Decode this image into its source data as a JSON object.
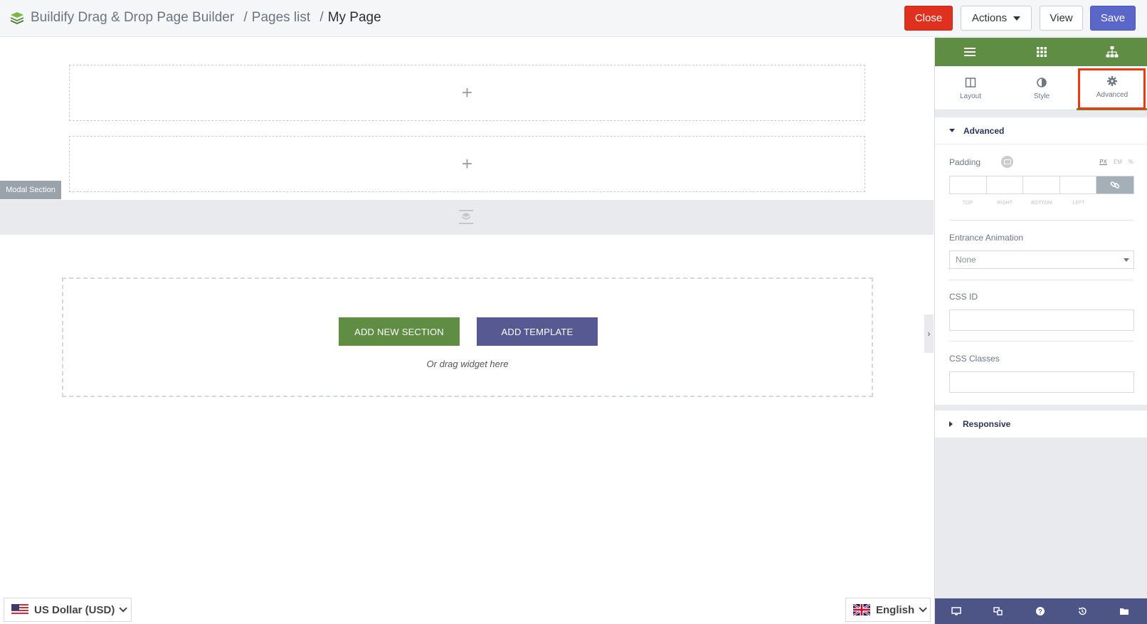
{
  "header": {
    "app_title": "Buildify Drag & Drop Page Builder",
    "sep1": "/",
    "crumb_pages": "Pages list",
    "sep2": "/",
    "crumb_current": "My Page",
    "close_label": "Close",
    "actions_label": "Actions",
    "view_label": "View",
    "save_label": "Save"
  },
  "canvas": {
    "slot_plus": "+",
    "modal_section_label": "Modal Section",
    "add_section_label": "ADD NEW SECTION",
    "add_template_label": "ADD TEMPLATE",
    "drag_hint": "Or drag widget here",
    "collapse_icon": "›"
  },
  "footer": {
    "currency_label": "US Dollar (USD)",
    "language_label": "English"
  },
  "panel": {
    "tabs": [
      {
        "label": "Layout",
        "icon": "columns-icon"
      },
      {
        "label": "Style",
        "icon": "half-circle-icon"
      },
      {
        "label": "Advanced",
        "icon": "gear-icon",
        "active": true
      }
    ],
    "advanced_section": "Advanced",
    "padding_label": "Padding",
    "units": [
      "PX",
      "EM",
      "%"
    ],
    "dim_labels": [
      "TOP",
      "RIGHT",
      "BOTTOM",
      "LEFT"
    ],
    "entrance_label": "Entrance Animation",
    "entrance_value": "None",
    "css_id_label": "CSS ID",
    "css_classes_label": "CSS Classes",
    "responsive_section": "Responsive"
  },
  "colors": {
    "brand_green": "#5f8d43",
    "close_red": "#e0301e",
    "save_blue": "#5a67c8",
    "template_purple": "#575a92",
    "footer_navy": "#4c5586",
    "highlight": "#ea3a12"
  }
}
